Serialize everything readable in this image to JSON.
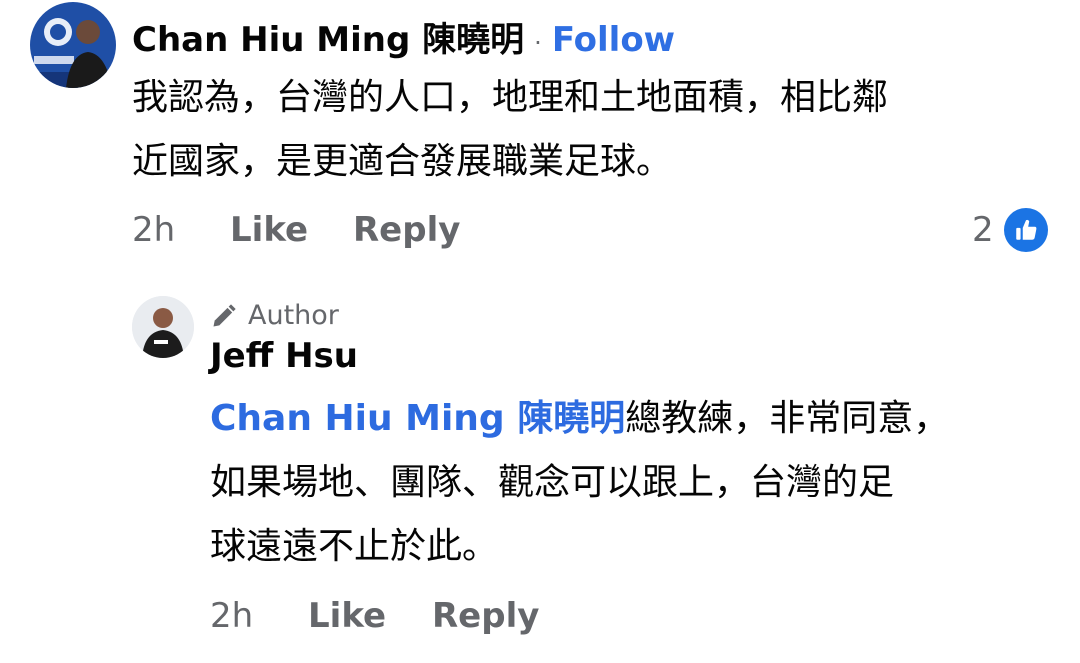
{
  "comment": {
    "author": "Chan Hiu Ming 陳曉明",
    "separator": "·",
    "follow_label": "Follow",
    "text_line1": "我認為，台灣的人口，地理和土地面積，相比鄰",
    "text_line2": "近國家，是更適合發展職業足球。",
    "time": "2h",
    "like_label": "Like",
    "reply_label": "Reply",
    "reaction_count": "2",
    "avatar_icon": "profile-photo",
    "reaction_icon": "thumbs-up-icon",
    "colors": {
      "link": "#2f6fe3",
      "like_badge": "#1b74e4",
      "meta": "#65676b"
    }
  },
  "reply": {
    "badge_label": "Author",
    "badge_icon": "pencil-icon",
    "author": "Jeff Hsu",
    "mention": "Chan Hiu Ming 陳曉明",
    "text_line1_rest": "總教練，非常同意，",
    "text_line2": "如果場地、團隊、觀念可以跟上，台灣的足",
    "text_line3": "球遠遠不止於此。",
    "time": "2h",
    "like_label": "Like",
    "reply_label": "Reply",
    "avatar_icon": "profile-photo"
  }
}
